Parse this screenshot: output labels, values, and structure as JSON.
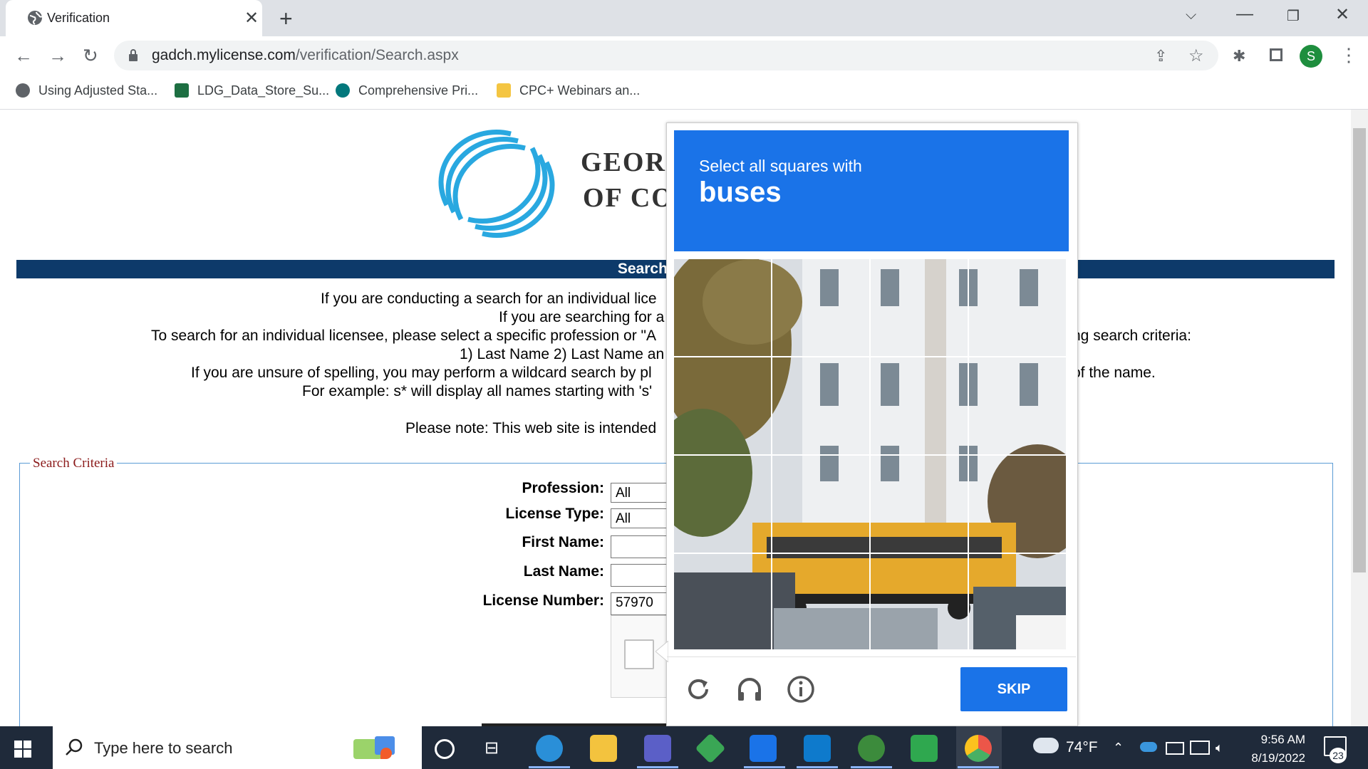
{
  "browser": {
    "tab_title": "Verification",
    "url_host": "gadch.mylicense.com",
    "url_path": "/verification/Search.aspx",
    "profile_initial": "S",
    "bookmarks": [
      {
        "label": "Using Adjusted Sta...",
        "icon": "globe-icon"
      },
      {
        "label": "LDG_Data_Store_Su...",
        "icon": "excel-icon"
      },
      {
        "label": "Comprehensive Pri...",
        "icon": "sharepoint-icon"
      },
      {
        "label": "CPC+ Webinars an...",
        "icon": "folder-icon"
      }
    ]
  },
  "page": {
    "logo_line1": "GEOR",
    "logo_line2": "OF CO",
    "banner": "Search for a Pro",
    "intro_lines": [
      "If you are conducting a search for an individual lice",
      "If you are searching for a",
      "To search for an individual licensee, please select a specific profession or \"A",
      "ng search criteria:",
      "1) Last Name 2) Last Name an",
      "If you are unsure of spelling, you may perform a wildcard search by pl",
      "of the name.",
      "For example: s* will display all names starting with 's'",
      "Please note: This web site is intended"
    ],
    "fieldset_legend": "Search Criteria",
    "form": {
      "profession_label": "Profession:",
      "profession_value": "All",
      "license_type_label": "License Type:",
      "license_type_value": "All",
      "first_name_label": "First Name:",
      "first_name_value": "",
      "last_name_label": "Last Name:",
      "last_name_value": "",
      "license_number_label": "License Number:",
      "license_number_value": "57970"
    }
  },
  "captcha": {
    "prompt": "Select all squares with",
    "object": "buses",
    "skip_label": "SKIP",
    "header_color": "#1a73e8"
  },
  "taskbar": {
    "search_placeholder": "Type here to search",
    "weather": "74°F",
    "time": "9:56 AM",
    "date": "8/19/2022",
    "notification_count": "23"
  }
}
